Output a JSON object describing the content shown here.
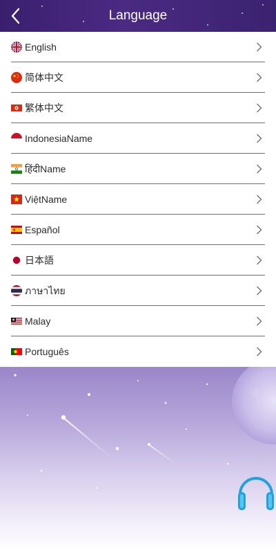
{
  "header": {
    "title": "Language",
    "back_icon": "chevron-left-icon"
  },
  "languages": [
    {
      "label": "English",
      "flag": "uk-flag-icon"
    },
    {
      "label": "简体中文",
      "flag": "china-flag-icon"
    },
    {
      "label": "繁体中文",
      "flag": "hongkong-flag-icon"
    },
    {
      "label": "IndonesiaName",
      "flag": "indonesia-flag-icon"
    },
    {
      "label": "हिंदीName",
      "flag": "india-flag-icon"
    },
    {
      "label": "ViệtName",
      "flag": "vietnam-flag-icon"
    },
    {
      "label": "Español",
      "flag": "spain-flag-icon"
    },
    {
      "label": "日本語",
      "flag": "japan-flag-icon"
    },
    {
      "label": "ภาษาไทย",
      "flag": "thailand-flag-icon"
    },
    {
      "label": "Malay",
      "flag": "malaysia-flag-icon"
    },
    {
      "label": "Português",
      "flag": "portugal-flag-icon"
    }
  ],
  "support": {
    "icon": "headset-icon"
  },
  "colors": {
    "header": "#3a1f6e",
    "divider": "#6e6e6e",
    "support_blue": "#1fa3e0"
  }
}
